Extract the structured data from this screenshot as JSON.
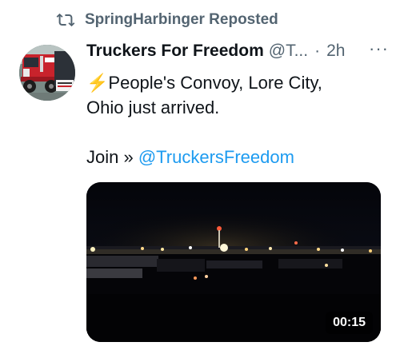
{
  "repost": {
    "icon": "repost-icon",
    "label": "SpringHarbinger Reposted"
  },
  "post": {
    "avatar_icon": "truck-avatar",
    "display_name": "Truckers For Freedom",
    "handle": "@T...",
    "separator": "·",
    "time": "2h",
    "more_label": "···",
    "bolt": "⚡",
    "line1": "People's Convoy, Lore City,",
    "line2": "Ohio just arrived.",
    "join_prefix": "Join » ",
    "join_link": "@TruckersFreedom",
    "video": {
      "duration": "00:15"
    }
  },
  "colors": {
    "text": "#0f1419",
    "secondary": "#536471",
    "link": "#1d9bf0",
    "bolt": "#f5b82e"
  }
}
